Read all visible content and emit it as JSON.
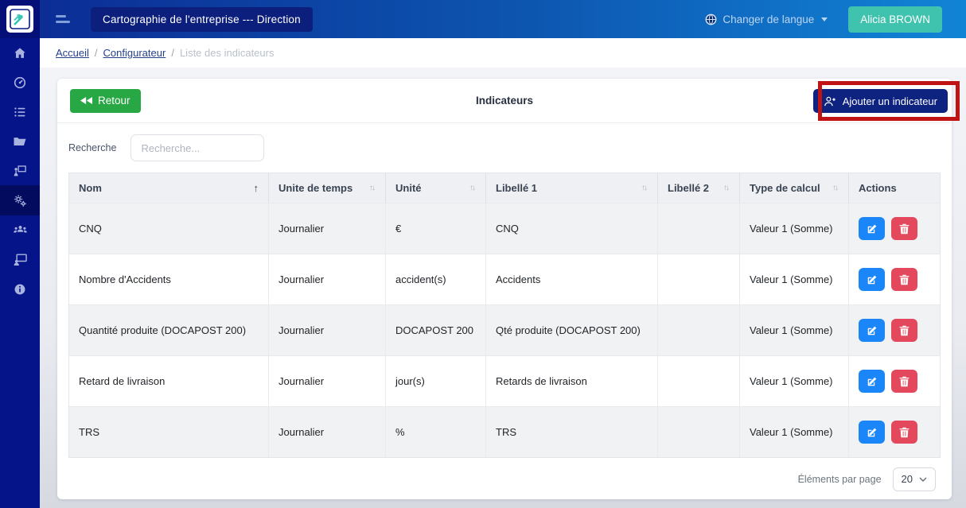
{
  "navbar": {
    "app_title": "Cartographie de l'entreprise --- Direction",
    "language_menu_label": "Changer de langue",
    "user_name": "Alicia BROWN"
  },
  "breadcrumb": {
    "separator": "/",
    "items": [
      "Accueil",
      "Configurateur",
      "Liste des indicateurs"
    ]
  },
  "sidebar": {
    "items": [
      {
        "icon": "home-icon"
      },
      {
        "icon": "dashboard-icon"
      },
      {
        "icon": "list-icon"
      },
      {
        "icon": "folder-icon"
      },
      {
        "icon": "presentation-icon"
      },
      {
        "icon": "settings-icon",
        "active": true
      },
      {
        "icon": "users-icon"
      },
      {
        "icon": "training-icon"
      },
      {
        "icon": "info-icon"
      }
    ]
  },
  "toolbar": {
    "back_label": "Retour",
    "page_title": "Indicateurs",
    "add_button_label": "Ajouter un indicateur"
  },
  "search": {
    "label": "Recherche",
    "placeholder": "Recherche..."
  },
  "table": {
    "columns": [
      "Nom",
      "Unite de temps",
      "Unité",
      "Libellé 1",
      "Libellé 2",
      "Type de calcul",
      "Actions"
    ],
    "sorted_column": "Nom",
    "rows": [
      {
        "nom": "CNQ",
        "unite_temps": "Journalier",
        "unite": "€",
        "libelle1": "CNQ",
        "libelle2": "",
        "type_calcul": "Valeur 1 (Somme)"
      },
      {
        "nom": "Nombre d'Accidents",
        "unite_temps": "Journalier",
        "unite": "accident(s)",
        "libelle1": "Accidents",
        "libelle2": "",
        "type_calcul": "Valeur 1 (Somme)"
      },
      {
        "nom": "Quantité produite (DOCAPOST 200)",
        "unite_temps": "Journalier",
        "unite": "DOCAPOST 200",
        "libelle1": "Qté produite (DOCAPOST 200)",
        "libelle2": "",
        "type_calcul": "Valeur 1 (Somme)"
      },
      {
        "nom": "Retard de livraison",
        "unite_temps": "Journalier",
        "unite": "jour(s)",
        "libelle1": "Retards de livraison",
        "libelle2": "",
        "type_calcul": "Valeur 1 (Somme)"
      },
      {
        "nom": "TRS",
        "unite_temps": "Journalier",
        "unite": "%",
        "libelle1": "TRS",
        "libelle2": "",
        "type_calcul": "Valeur 1 (Somme)"
      }
    ]
  },
  "pagination": {
    "per_page_label": "Éléments par page",
    "per_page_value": "20"
  },
  "icons": {
    "sort_asc": "↑",
    "sort_both": "↑↓"
  },
  "colors": {
    "navbar_gradient_start": "#0b2a93",
    "navbar_gradient_end": "#1184d6",
    "sidebar_bg": "#051488",
    "sidebar_active_bg": "#030b5e",
    "brand_teal": "#3fc2ae",
    "back_green": "#28a745",
    "add_navy": "#0e2280",
    "edit_blue": "#1a86f8",
    "delete_red": "#e4485c",
    "highlight_red": "#c01414",
    "table_header_bg": "#eef0f3",
    "row_stripe_bg": "#f1f2f4"
  }
}
